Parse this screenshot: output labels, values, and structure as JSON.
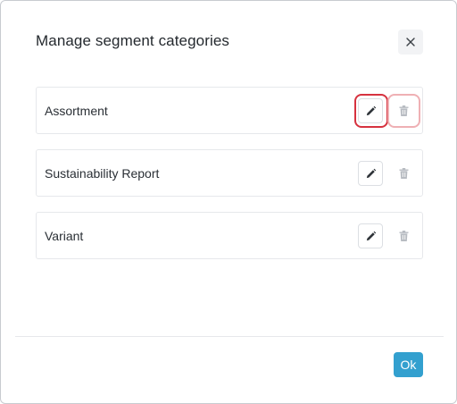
{
  "dialog": {
    "title": "Manage segment categories",
    "close_icon": "close-icon",
    "ok_label": "Ok"
  },
  "categories": [
    {
      "label": "Assortment",
      "edit_icon": "pencil-icon",
      "delete_icon": "trash-icon",
      "highlighted": true
    },
    {
      "label": "Sustainability Report",
      "edit_icon": "pencil-icon",
      "delete_icon": "trash-icon",
      "highlighted": false
    },
    {
      "label": "Variant",
      "edit_icon": "pencil-icon",
      "delete_icon": "trash-icon",
      "highlighted": false
    }
  ],
  "colors": {
    "accent": "#33a0cf",
    "highlight": "#d6323f",
    "highlight_light": "#efb0b4",
    "disabled_icon": "#b8bcc2"
  }
}
